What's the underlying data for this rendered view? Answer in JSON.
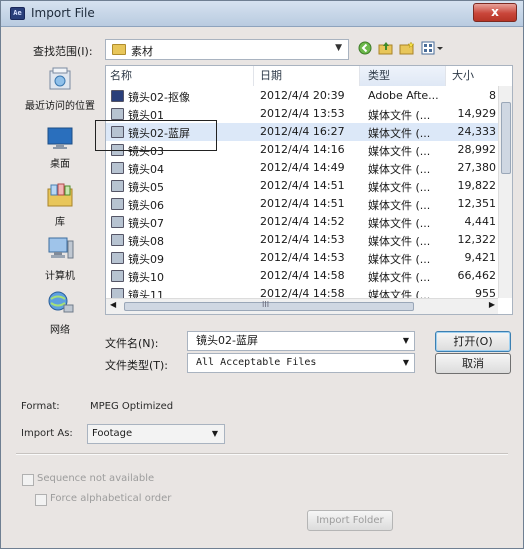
{
  "window": {
    "title": "Import File",
    "app_icon_text": "Ae",
    "close_glyph": "x"
  },
  "look_in": {
    "label": "查找范围(I):",
    "value": "素材"
  },
  "toolbar": {
    "icons": [
      "back-icon",
      "up-folder-icon",
      "new-folder-icon",
      "view-menu-icon"
    ]
  },
  "places": [
    {
      "label": "最近访问的位置",
      "icon": "recent-places-icon"
    },
    {
      "label": "桌面",
      "icon": "desktop-icon"
    },
    {
      "label": "库",
      "icon": "libraries-icon"
    },
    {
      "label": "计算机",
      "icon": "computer-icon"
    },
    {
      "label": "网络",
      "icon": "network-icon"
    }
  ],
  "columns": {
    "name": "名称",
    "date": "日期",
    "type": "类型",
    "size": "大小"
  },
  "files": [
    {
      "name": "镜头02-抠像",
      "date": "2012/4/4 20:39",
      "type": "Adobe Afte...",
      "size": "8"
    },
    {
      "name": "镜头01",
      "date": "2012/4/4 13:53",
      "type": "媒体文件 (...",
      "size": "14,929"
    },
    {
      "name": "镜头02-蓝屏",
      "date": "2012/4/4 16:27",
      "type": "媒体文件 (...",
      "size": "24,333"
    },
    {
      "name": "镜头03",
      "date": "2012/4/4 14:16",
      "type": "媒体文件 (...",
      "size": "28,992"
    },
    {
      "name": "镜头04",
      "date": "2012/4/4 14:49",
      "type": "媒体文件 (...",
      "size": "27,380"
    },
    {
      "name": "镜头05",
      "date": "2012/4/4 14:51",
      "type": "媒体文件 (...",
      "size": "19,822"
    },
    {
      "name": "镜头06",
      "date": "2012/4/4 14:51",
      "type": "媒体文件 (...",
      "size": "12,351"
    },
    {
      "name": "镜头07",
      "date": "2012/4/4 14:52",
      "type": "媒体文件 (...",
      "size": "4,441"
    },
    {
      "name": "镜头08",
      "date": "2012/4/4 14:53",
      "type": "媒体文件 (...",
      "size": "12,322"
    },
    {
      "name": "镜头09",
      "date": "2012/4/4 14:53",
      "type": "媒体文件 (...",
      "size": "9,421"
    },
    {
      "name": "镜头10",
      "date": "2012/4/4 14:58",
      "type": "媒体文件 (...",
      "size": "66,462"
    },
    {
      "name": "镜头11",
      "date": "2012/4/4 14:58",
      "type": "媒体文件 (...",
      "size": "955"
    }
  ],
  "selected_file_index": 2,
  "hscroll_glyph": "III",
  "filename": {
    "label": "文件名(N):",
    "value": "镜头02-蓝屏"
  },
  "filetype": {
    "label": "文件类型(T):",
    "value": "All Acceptable Files"
  },
  "buttons": {
    "open": "打开(O)",
    "cancel": "取消",
    "import_folder": "Import Folder"
  },
  "format": {
    "label": "Format:",
    "value": "MPEG Optimized"
  },
  "import_as": {
    "label": "Import As:",
    "value": "Footage"
  },
  "options": {
    "sequence": "Sequence not available",
    "force_alpha": "Force alphabetical order"
  },
  "colors": {
    "selection": "#dce8f8",
    "title_bar": "#c4d4e8",
    "close": "#c9463a"
  }
}
